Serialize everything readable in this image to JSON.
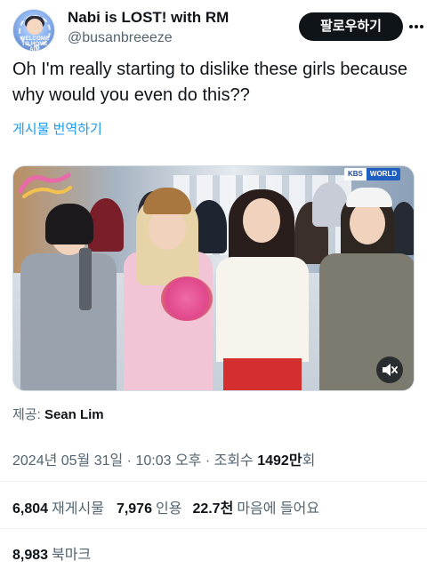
{
  "author": {
    "display_name": "Nabi is LOST! with RM",
    "handle": "@busanbreeeze",
    "avatar_text": "WELCOME TO HOME AIM"
  },
  "header": {
    "follow_label": "팔로우하기",
    "more_icon": "more-icon"
  },
  "tweet": {
    "text": "Oh I'm really starting to dislike these girls because why would you even do this??",
    "translate_label": "게시물 번역하기"
  },
  "media": {
    "broadcaster": "KBS",
    "channel": "WORLD",
    "mute_icon": "mute-icon"
  },
  "source": {
    "label": "제공:",
    "name": "Sean Lim"
  },
  "meta": {
    "timestamp": "2024년 05월 31일 · 10:03 오후 ·",
    "views_label": "조회수",
    "views_value": "1492만",
    "views_suffix": "회"
  },
  "stats": [
    {
      "value": "6,804",
      "label": "재게시물"
    },
    {
      "value": "7,976",
      "label": "인용"
    },
    {
      "value": "22.7천",
      "label": "마음에 들어요"
    }
  ],
  "bookmarks": {
    "value": "8,983",
    "label": "북마크"
  },
  "colors": {
    "text": "#0f1419",
    "secondary": "#536471",
    "link": "#1d9bf0",
    "button": "#0f1419"
  }
}
